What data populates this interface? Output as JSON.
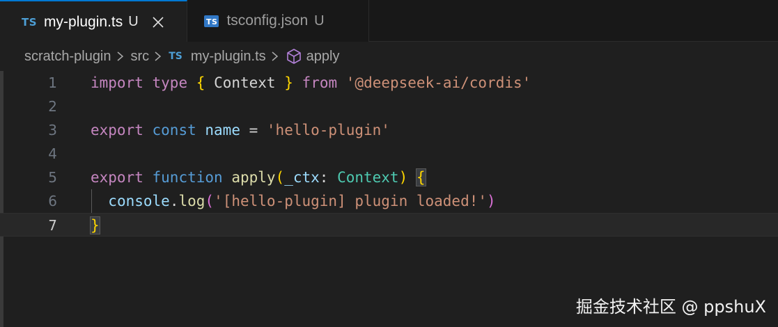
{
  "tabs": [
    {
      "badge": "TS",
      "name": "my-plugin.ts",
      "status": "U",
      "active": true
    },
    {
      "badge": "TS",
      "name": "tsconfig.json",
      "status": "U",
      "active": false
    }
  ],
  "breadcrumb": {
    "items": [
      "scratch-plugin",
      "src",
      "my-plugin.ts",
      "apply"
    ],
    "file_badge": "TS"
  },
  "code": {
    "line_numbers": [
      "1",
      "2",
      "3",
      "4",
      "5",
      "6",
      "7"
    ],
    "current_line": "7",
    "lines": [
      [
        {
          "t": "import",
          "c": "kw-purple"
        },
        {
          "t": " ",
          "c": "plain"
        },
        {
          "t": "type",
          "c": "kw-purple"
        },
        {
          "t": " ",
          "c": "plain"
        },
        {
          "t": "{",
          "c": "brace-gold"
        },
        {
          "t": " ",
          "c": "plain"
        },
        {
          "t": "Context",
          "c": "plain"
        },
        {
          "t": " ",
          "c": "plain"
        },
        {
          "t": "}",
          "c": "brace-gold"
        },
        {
          "t": " ",
          "c": "plain"
        },
        {
          "t": "from",
          "c": "kw-purple"
        },
        {
          "t": " ",
          "c": "plain"
        },
        {
          "t": "'@deepseek-ai/cordis'",
          "c": "str"
        }
      ],
      [],
      [
        {
          "t": "export",
          "c": "kw-purple"
        },
        {
          "t": " ",
          "c": "plain"
        },
        {
          "t": "const",
          "c": "kw-blue"
        },
        {
          "t": " ",
          "c": "plain"
        },
        {
          "t": "name",
          "c": "ident"
        },
        {
          "t": " = ",
          "c": "plain"
        },
        {
          "t": "'hello-plugin'",
          "c": "str"
        }
      ],
      [],
      [
        {
          "t": "export",
          "c": "kw-purple"
        },
        {
          "t": " ",
          "c": "plain"
        },
        {
          "t": "function",
          "c": "kw-blue"
        },
        {
          "t": " ",
          "c": "plain"
        },
        {
          "t": "apply",
          "c": "fn"
        },
        {
          "t": "(",
          "c": "brace-gold"
        },
        {
          "t": "_ctx",
          "c": "ident"
        },
        {
          "t": ": ",
          "c": "plain"
        },
        {
          "t": "Context",
          "c": "type"
        },
        {
          "t": ")",
          "c": "brace-gold"
        },
        {
          "t": " ",
          "c": "plain"
        },
        {
          "t": "{",
          "c": "brace-gold brace-hl"
        }
      ],
      [
        {
          "t": "  ",
          "c": "plain"
        },
        {
          "t": "console",
          "c": "ident"
        },
        {
          "t": ".",
          "c": "plain"
        },
        {
          "t": "log",
          "c": "fn"
        },
        {
          "t": "(",
          "c": "paren-pink"
        },
        {
          "t": "'[hello-plugin] plugin loaded!'",
          "c": "str"
        },
        {
          "t": ")",
          "c": "paren-pink"
        }
      ],
      [
        {
          "t": "}",
          "c": "brace-gold brace-hl"
        }
      ]
    ]
  },
  "watermark": "掘金技术社区 @ ppshuX",
  "icons": {
    "tab_close": "close-icon",
    "breadcrumb_separator": "chevron-right-icon",
    "symbol": "cube-icon"
  },
  "colors": {
    "accent": "#0078d4",
    "editor_bg": "#1f1f1f",
    "tabbar_bg": "#181818"
  }
}
